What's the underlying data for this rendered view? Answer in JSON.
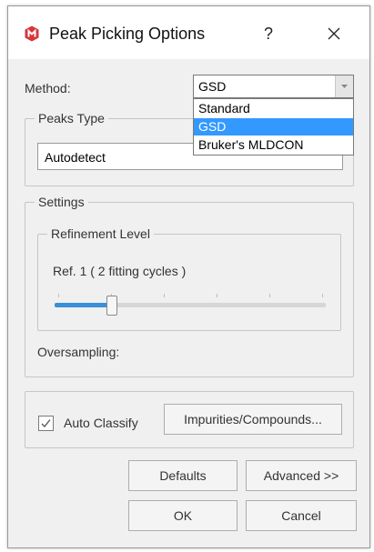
{
  "dialog": {
    "title": "Peak Picking Options",
    "help_label": "?",
    "close_icon": "close-icon",
    "app_icon": "mnova-logo-icon",
    "accent_color": "#d6363b"
  },
  "method": {
    "label": "Method:",
    "value": "GSD",
    "options": [
      "Standard",
      "GSD",
      "Bruker's MLDCON"
    ],
    "selected_index": 1
  },
  "peaks_type": {
    "title": "Peaks Type",
    "value": "Autodetect"
  },
  "settings": {
    "title": "Settings",
    "refinement": {
      "title": "Refinement Level",
      "level_text": "Ref. 1 ( 2 fitting cycles )",
      "slider_value": 1,
      "slider_max": 5
    },
    "oversampling_label": "Oversampling:"
  },
  "classify": {
    "auto_classify_label": "Auto Classify",
    "auto_classify_checked": true,
    "impurities_button": "Impurities/Compounds..."
  },
  "buttons": {
    "defaults": "Defaults",
    "advanced": "Advanced >>",
    "ok": "OK",
    "cancel": "Cancel"
  }
}
